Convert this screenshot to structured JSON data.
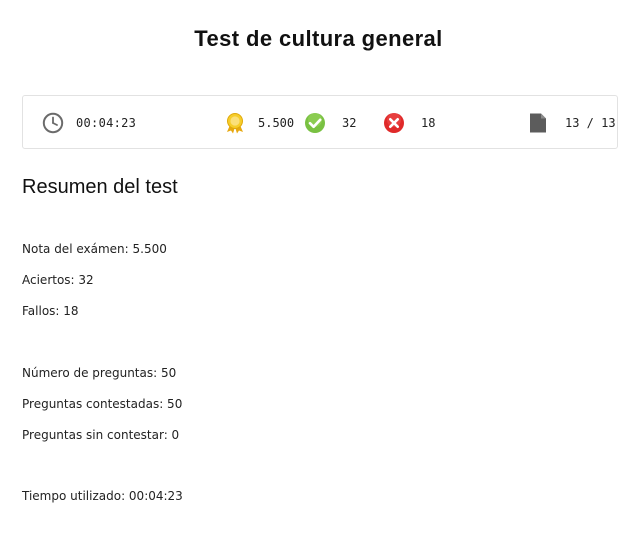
{
  "page": {
    "title": "Test de cultura general"
  },
  "status_bar": {
    "time": {
      "icon": "clock-icon",
      "value": "00:04:23"
    },
    "score": {
      "icon": "medal-icon",
      "value": "5.500",
      "color": "#f3c21a"
    },
    "correct": {
      "icon": "check-circle-icon",
      "value": "32",
      "color": "#79c142"
    },
    "wrong": {
      "icon": "x-circle-icon",
      "value": "18",
      "color": "#e02a2a"
    },
    "pages": {
      "icon": "document-icon",
      "value": "13 / 13"
    }
  },
  "summary": {
    "heading": "Resumen del test",
    "grade": "Nota del exámen: 5.500",
    "correct": "Aciertos: 32",
    "wrong": "Fallos: 18",
    "total_questions": "Número de preguntas: 50",
    "answered": "Preguntas contestadas: 50",
    "unanswered": "Preguntas sin contestar: 0",
    "time_used": "Tiempo utilizado: 00:04:23"
  }
}
